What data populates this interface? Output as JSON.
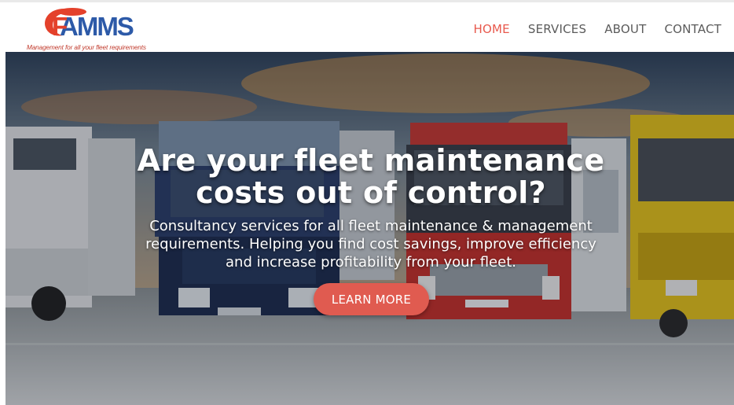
{
  "brand": {
    "logo_text": "FAMMS",
    "tagline": "Management for all your fleet requirements"
  },
  "nav": {
    "items": [
      {
        "label": "HOME",
        "active": true
      },
      {
        "label": "SERVICES",
        "active": false
      },
      {
        "label": "ABOUT",
        "active": false
      },
      {
        "label": "CONTACT",
        "active": false
      }
    ]
  },
  "hero": {
    "headline_line1": "Are your fleet maintenance",
    "headline_line2": "costs out of control?",
    "sub_line1": "Consultancy services for all fleet maintenance & management",
    "sub_line2": "requirements. Helping you find cost savings, improve efficiency",
    "sub_line3": "and increase profitability from your fleet.",
    "cta_label": "LEARN MORE",
    "background_image": "trucks-parked-at-sunset"
  },
  "colors": {
    "accent": "#e8594d",
    "button": "#e05b50",
    "logo_red": "#e4412b",
    "logo_blue": "#2d5aa8",
    "nav_text": "#5b5b5b"
  }
}
